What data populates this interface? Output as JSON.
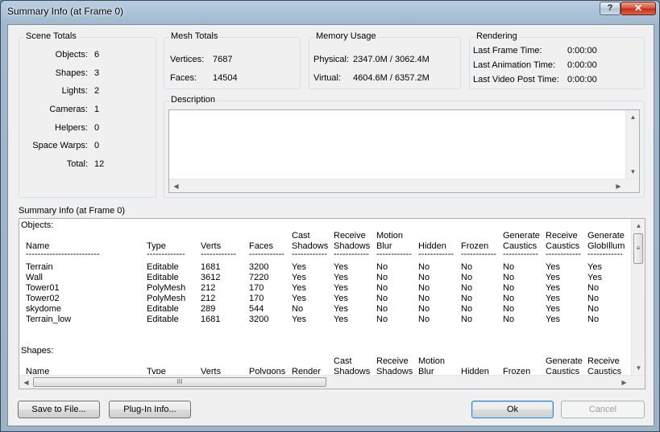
{
  "window": {
    "title": "Summary Info (at Frame 0)",
    "help_glyph": "?",
    "close_glyph": "✕"
  },
  "scene_totals": {
    "title": "Scene Totals",
    "rows": [
      {
        "label": "Objects:",
        "value": "6"
      },
      {
        "label": "Shapes:",
        "value": "3"
      },
      {
        "label": "Lights:",
        "value": "2"
      },
      {
        "label": "Cameras:",
        "value": "1"
      },
      {
        "label": "Helpers:",
        "value": "0"
      },
      {
        "label": "Space Warps:",
        "value": "0"
      },
      {
        "label": "Total:",
        "value": "12"
      }
    ]
  },
  "mesh_totals": {
    "title": "Mesh Totals",
    "rows": [
      {
        "label": "Vertices:",
        "value": "7687"
      },
      {
        "label": "Faces:",
        "value": "14504"
      }
    ]
  },
  "memory_usage": {
    "title": "Memory Usage",
    "rows": [
      {
        "label": "Physical:",
        "value": "2347.0M / 3062.4M"
      },
      {
        "label": "Virtual:",
        "value": "4604.6M / 6357.2M"
      }
    ]
  },
  "rendering": {
    "title": "Rendering",
    "rows": [
      {
        "label": "Last Frame Time:",
        "value": "0:00:00"
      },
      {
        "label": "Last Animation Time:",
        "value": "0:00:00"
      },
      {
        "label": "Last Video Post Time:",
        "value": "0:00:00"
      }
    ]
  },
  "description": {
    "title": "Description",
    "value": ""
  },
  "summary": {
    "title": "Summary Info (at Frame 0)",
    "objects_heading": "Objects:",
    "objects_headers": [
      [
        "",
        "Name"
      ],
      [
        "",
        "Type"
      ],
      [
        "",
        "Verts"
      ],
      [
        "",
        "Faces"
      ],
      [
        "Cast",
        "Shadows"
      ],
      [
        "Receive",
        "Shadows"
      ],
      [
        "Motion",
        "Blur"
      ],
      [
        "",
        "Hidden"
      ],
      [
        "",
        "Frozen"
      ],
      [
        "Generate",
        "Caustics"
      ],
      [
        "Receive",
        "Caustics"
      ],
      [
        "Generate",
        "GlobIllum"
      ]
    ],
    "dashes": [
      "-------------------------",
      "-------------",
      "------------",
      "------------",
      "------------",
      "------------",
      "------------",
      "------------",
      "------------",
      "------------",
      "------------",
      "------------"
    ],
    "objects_rows": [
      [
        "Terrain",
        "Editable",
        "1681",
        "3200",
        "Yes",
        "Yes",
        "No",
        "No",
        "No",
        "No",
        "Yes",
        "Yes"
      ],
      [
        "Wall",
        "Editable",
        "3612",
        "7220",
        "Yes",
        "Yes",
        "No",
        "No",
        "No",
        "No",
        "Yes",
        "Yes"
      ],
      [
        "Tower01",
        "PolyMesh",
        "212",
        "170",
        "Yes",
        "Yes",
        "No",
        "No",
        "No",
        "No",
        "Yes",
        "No"
      ],
      [
        "Tower02",
        "PolyMesh",
        "212",
        "170",
        "Yes",
        "Yes",
        "No",
        "No",
        "No",
        "No",
        "Yes",
        "No"
      ],
      [
        "skydome",
        "Editable",
        "289",
        "544",
        "No",
        "Yes",
        "No",
        "No",
        "No",
        "No",
        "Yes",
        "No"
      ],
      [
        "Terrain_low",
        "Editable",
        "1681",
        "3200",
        "Yes",
        "Yes",
        "No",
        "No",
        "No",
        "No",
        "Yes",
        "No"
      ]
    ],
    "shapes_heading": "Shapes:",
    "shapes_headers": [
      [
        "",
        "Name"
      ],
      [
        "",
        "Type"
      ],
      [
        "",
        "Verts"
      ],
      [
        "",
        "Polygons"
      ],
      [
        "",
        "Render"
      ],
      [
        "Cast",
        "Shadows"
      ],
      [
        "Receive",
        "Shadows"
      ],
      [
        "Motion",
        "Blur"
      ],
      [
        "",
        "Hidden"
      ],
      [
        "",
        "Frozen"
      ],
      [
        "Generate",
        "Caustics"
      ],
      [
        "Receive",
        "Caustics"
      ]
    ],
    "hscroll_grip": "III"
  },
  "buttons": {
    "save": "Save to File...",
    "plugin": "Plug-In Info...",
    "ok": "Ok",
    "cancel": "Cancel"
  }
}
